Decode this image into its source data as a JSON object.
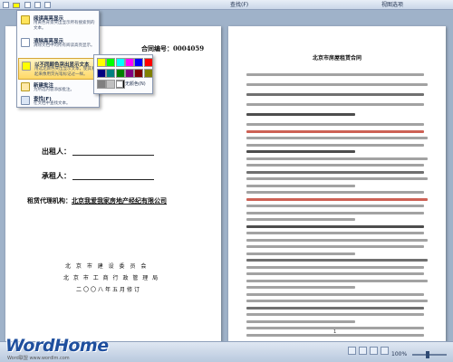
{
  "toolbar": {
    "find_label": "查找(F)",
    "view_label": "视图选项",
    "highlight_color": "#ffff00"
  },
  "left_page": {
    "contract_no": "合同编号：0004059",
    "lessor": "出租人：",
    "lessee": "承租人：",
    "agent_label": "租赁代理机构：",
    "agent_name": "北京我爱我家房地产经纪有限公司",
    "issuer1": "北 京 市 建 设 委 员 会",
    "issuer2": "北 京 市 工 商 行 政 管 理 局",
    "issuer3": "二〇〇八年五月修订"
  },
  "right_page": {
    "title": "北京市房屋租赁合同",
    "page_number": "1"
  },
  "menu": {
    "items": [
      {
        "title": "阅读高亮显示",
        "desc": "用黄色背景突出显示所有搜索到的文本。",
        "icon": "highlight-icon"
      },
      {
        "title": "清除高亮显示",
        "desc": "清除文档中的所有阅读高亮显示。",
        "icon": "clear-icon"
      },
      {
        "title": "以不同颜色突出显示文本",
        "desc": "用选定颜色突出显示文本，使其看起来像用荧光笔标记过一样。",
        "icon": "marker-icon"
      },
      {
        "title": "新建批注",
        "desc": "为所选内容添加批注。",
        "icon": "comment-icon"
      },
      {
        "title": "查找(F)",
        "desc": "在文档中查找文本。",
        "icon": "search-icon"
      }
    ]
  },
  "palette": {
    "colors": [
      "#ffff00",
      "#00ff00",
      "#00ffff",
      "#ff00ff",
      "#0000ff",
      "#ff0000",
      "#000080",
      "#008080",
      "#008000",
      "#800080",
      "#800000",
      "#808000",
      "#808080",
      "#c0c0c0",
      "#000000"
    ],
    "no_color_label": "无颜色(N)"
  },
  "statusbar": {
    "zoom": "100%"
  },
  "watermark": {
    "brand": "WordHome",
    "sub": "Word联盟 www.wordlm.com"
  }
}
